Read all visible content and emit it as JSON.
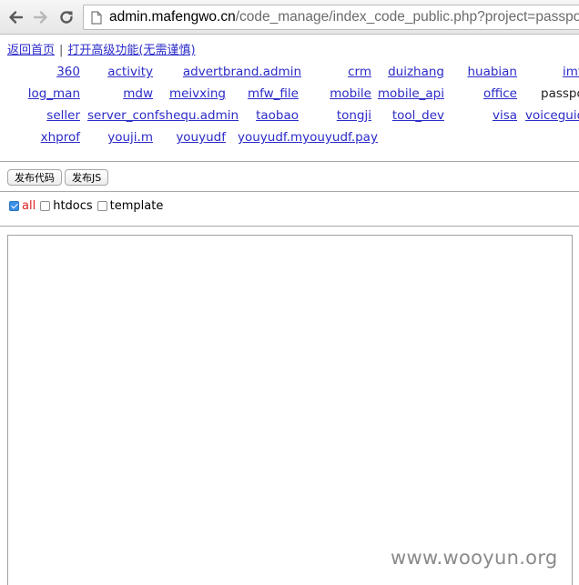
{
  "browser": {
    "url_host": "admin.mafengwo.cn",
    "url_path": "/code_manage/index_code_public.php?project=passport"
  },
  "top_links": {
    "home": "返回首页",
    "separator": "|",
    "advanced": "打开高级功能(无需谨慎)"
  },
  "projects": {
    "rows": [
      [
        "360",
        "activity",
        "advertbrand.admin",
        "crm",
        "duizhang",
        "huabian",
        "imf"
      ],
      [
        "log_man",
        "mdw",
        "meivxing",
        "mfw_file",
        "mobile",
        "mobile_api",
        "office",
        "passport"
      ],
      [
        "seller",
        "server_confshequ.admin",
        "taobao",
        "tongji",
        "tool_dev",
        "visa",
        "voiceguide"
      ],
      [
        "xhprof",
        "youji.m",
        "youyudf",
        "youyudf.myouyudf.pay"
      ]
    ],
    "current": "passport"
  },
  "buttons": {
    "publish_code": "发布代码",
    "publish_js": "发布JS"
  },
  "filters": [
    {
      "label": "all",
      "checked": true
    },
    {
      "label": "htdocs",
      "checked": false
    },
    {
      "label": "template",
      "checked": false
    }
  ],
  "watermark": "www.wooyun.org",
  "colors": {
    "link": "#2b2bc9",
    "active_filter": "#e02020"
  }
}
